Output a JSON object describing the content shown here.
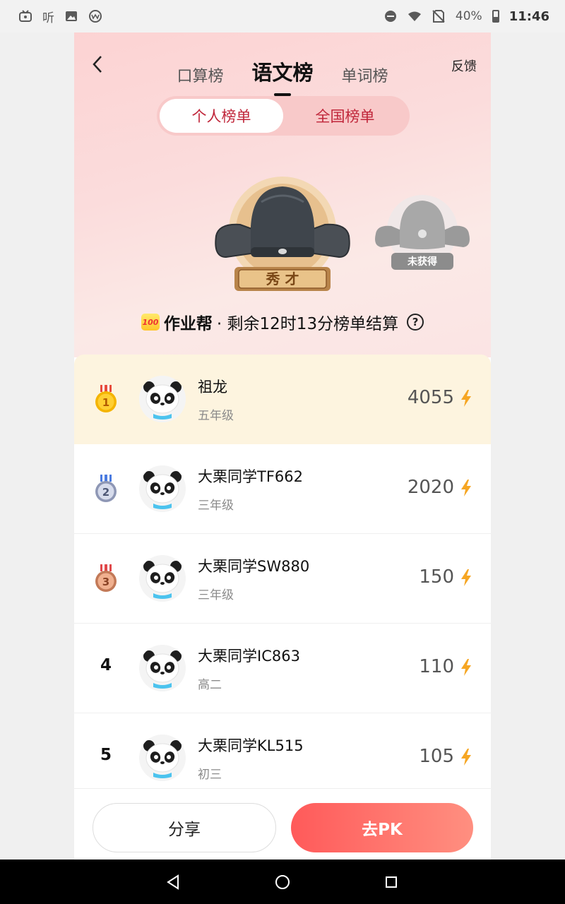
{
  "status_bar": {
    "left_text": "听",
    "battery": "40%",
    "time": "11:46"
  },
  "header": {
    "tabs": [
      "口算榜",
      "语文榜",
      "单词榜"
    ],
    "active_tab": 1,
    "feedback": "反馈"
  },
  "segment": {
    "personal": "个人榜单",
    "national": "全国榜单"
  },
  "badges": {
    "main_label": "秀 才",
    "locked_label": "未获得"
  },
  "notice": {
    "brand": "作业帮",
    "text": "· 剩余12时13分榜单结算",
    "logo_text": "100"
  },
  "leaderboard": [
    {
      "rank": "1",
      "name": "祖龙",
      "grade": "五年级",
      "score": "4055"
    },
    {
      "rank": "2",
      "name": "大栗同学TF662",
      "grade": "三年级",
      "score": "2020"
    },
    {
      "rank": "3",
      "name": "大栗同学SW880",
      "grade": "三年级",
      "score": "150"
    },
    {
      "rank": "4",
      "name": "大栗同学IC863",
      "grade": "高二",
      "score": "110"
    },
    {
      "rank": "5",
      "name": "大栗同学KL515",
      "grade": "初三",
      "score": "105"
    }
  ],
  "actions": {
    "share": "分享",
    "pk": "去PK"
  },
  "colors": {
    "accent_red": "#ff5a5a",
    "bolt": "#f6a623",
    "segment_text": "#c0263a"
  }
}
